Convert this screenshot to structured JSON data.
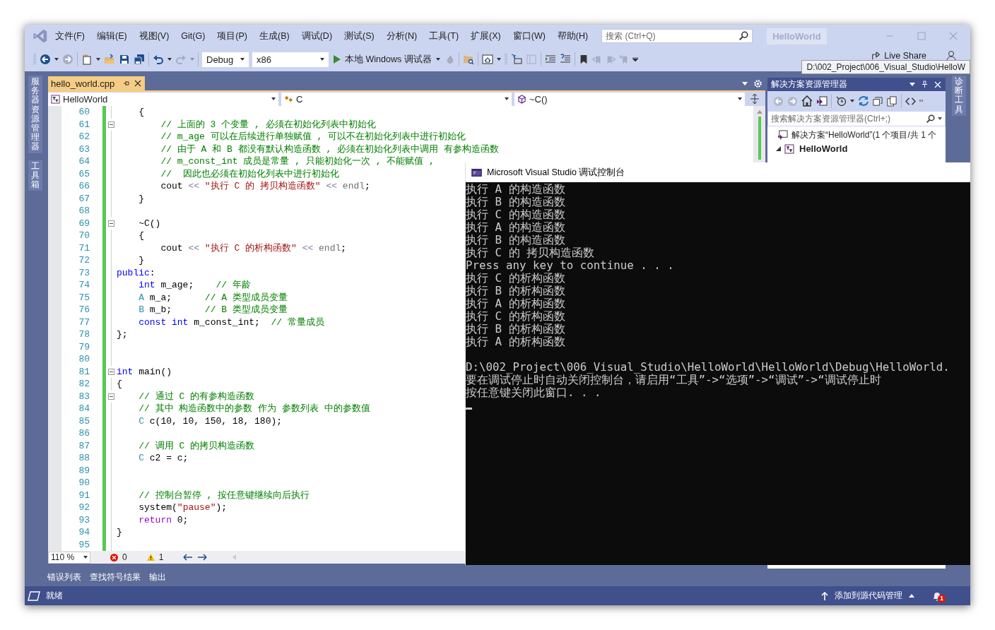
{
  "menu": [
    "文件(F)",
    "编辑(E)",
    "视图(V)",
    "Git(G)",
    "项目(P)",
    "生成(B)",
    "调试(D)",
    "测试(S)",
    "分析(N)",
    "工具(T)",
    "扩展(X)",
    "窗口(W)",
    "帮助(H)"
  ],
  "search": {
    "placeholder": "搜索 (Ctrl+Q)"
  },
  "solution_badge": "HelloWorld",
  "toolbar": {
    "configuration": "Debug",
    "platform": "x86",
    "start_label": "本地 Windows 调试器",
    "live_share": "Live Share"
  },
  "tooltip": "D:\\002_Project\\006_Visual_Studio\\HelloW",
  "left_strip": [
    "服务器资源管理器",
    "工具箱"
  ],
  "right_strip": [
    "诊断工具"
  ],
  "editor": {
    "tabs": [
      {
        "label": "hello_world.cpp",
        "selected": true
      }
    ],
    "nav": [
      "HelloWorld",
      "C",
      "~C()"
    ],
    "lines": [
      {
        "number": "60",
        "fold": false,
        "segs": [
          {
            "kind": "plain",
            "text": "    {"
          }
        ]
      },
      {
        "number": "61",
        "fold": true,
        "segs": [
          {
            "kind": "comment",
            "text": "        // 上面的 3 个变量 , 必须在初始化列表中初始化"
          }
        ]
      },
      {
        "number": "62",
        "fold": false,
        "segs": [
          {
            "kind": "comment",
            "text": "        // m_age 可以在后续进行单独赋值 , 可以不在初始化列表中进行初始化"
          }
        ]
      },
      {
        "number": "63",
        "fold": false,
        "segs": [
          {
            "kind": "comment",
            "text": "        // 由于 A 和 B 都没有默认构造函数 , 必须在初始化列表中调用 有参构造函数"
          }
        ]
      },
      {
        "number": "64",
        "fold": false,
        "segs": [
          {
            "kind": "comment",
            "text": "        // m_const_int 成员是常量 , 只能初始化一次 , 不能赋值 ,"
          }
        ]
      },
      {
        "number": "65",
        "fold": false,
        "segs": [
          {
            "kind": "comment",
            "text": "        //  因此也必须在初始化列表中进行初始化"
          }
        ]
      },
      {
        "number": "66",
        "fold": false,
        "segs": [
          {
            "kind": "plain",
            "text": "        cout "
          },
          {
            "kind": "op",
            "text": "<< "
          },
          {
            "kind": "string",
            "text": "\"执行 C 的 拷贝构造函数\""
          },
          {
            "kind": "op",
            "text": " << "
          },
          {
            "kind": "macro",
            "text": "endl"
          },
          {
            "kind": "plain",
            "text": ";"
          }
        ]
      },
      {
        "number": "67",
        "fold": false,
        "segs": [
          {
            "kind": "plain",
            "text": "    }"
          }
        ]
      },
      {
        "number": "68",
        "fold": false
      },
      {
        "number": "69",
        "fold": true,
        "segs": [
          {
            "kind": "plain",
            "text": "    ~C()"
          }
        ]
      },
      {
        "number": "70",
        "fold": false,
        "segs": [
          {
            "kind": "plain",
            "text": "    {"
          }
        ]
      },
      {
        "number": "71",
        "fold": false,
        "segs": [
          {
            "kind": "plain",
            "text": "        cout "
          },
          {
            "kind": "op",
            "text": "<< "
          },
          {
            "kind": "string",
            "text": "\"执行 C 的析构函数\""
          },
          {
            "kind": "op",
            "text": " << "
          },
          {
            "kind": "macro",
            "text": "endl"
          },
          {
            "kind": "plain",
            "text": ";"
          }
        ]
      },
      {
        "number": "72",
        "fold": false,
        "segs": [
          {
            "kind": "plain",
            "text": "    }"
          }
        ]
      },
      {
        "number": "73",
        "fold": false,
        "segs": [
          {
            "kind": "keyword",
            "text": "public"
          },
          {
            "kind": "plain",
            "text": ":"
          }
        ]
      },
      {
        "number": "74",
        "fold": false,
        "segs": [
          {
            "kind": "keyword",
            "text": "    int"
          },
          {
            "kind": "plain",
            "text": " m_age;    "
          },
          {
            "kind": "comment",
            "text": "// 年龄"
          }
        ]
      },
      {
        "number": "75",
        "fold": false,
        "segs": [
          {
            "kind": "type",
            "text": "    A"
          },
          {
            "kind": "plain",
            "text": " m_a;      "
          },
          {
            "kind": "comment",
            "text": "// A 类型成员变量"
          }
        ]
      },
      {
        "number": "76",
        "fold": false,
        "segs": [
          {
            "kind": "type",
            "text": "    B"
          },
          {
            "kind": "plain",
            "text": " m_b;      "
          },
          {
            "kind": "comment",
            "text": "// B 类型成员变量"
          }
        ]
      },
      {
        "number": "77",
        "fold": false,
        "segs": [
          {
            "kind": "keyword",
            "text": "    const int"
          },
          {
            "kind": "plain",
            "text": " m_const_int;  "
          },
          {
            "kind": "comment",
            "text": "// 常量成员"
          }
        ]
      },
      {
        "number": "78",
        "fold": false,
        "segs": [
          {
            "kind": "plain",
            "text": "};"
          }
        ]
      },
      {
        "number": "79",
        "fold": false
      },
      {
        "number": "80",
        "fold": false
      },
      {
        "number": "81",
        "fold": true,
        "segs": [
          {
            "kind": "keyword",
            "text": "int"
          },
          {
            "kind": "plain",
            "text": " main()"
          }
        ]
      },
      {
        "number": "82",
        "fold": false,
        "segs": [
          {
            "kind": "plain",
            "text": "{"
          }
        ]
      },
      {
        "number": "83",
        "fold": true,
        "segs": [
          {
            "kind": "comment",
            "text": "    // 通过 C 的有参构造函数"
          }
        ]
      },
      {
        "number": "84",
        "fold": false,
        "segs": [
          {
            "kind": "comment",
            "text": "    // 其中 构造函数中的参数 作为 参数列表 中的参数值"
          }
        ]
      },
      {
        "number": "85",
        "fold": false,
        "segs": [
          {
            "kind": "type",
            "text": "    C"
          },
          {
            "kind": "plain",
            "text": " c(10, 10, 150, 18, 180);"
          }
        ]
      },
      {
        "number": "86",
        "fold": false
      },
      {
        "number": "87",
        "fold": false,
        "segs": [
          {
            "kind": "comment",
            "text": "    // 调用 C 的拷贝构造函数"
          }
        ]
      },
      {
        "number": "88",
        "fold": false,
        "segs": [
          {
            "kind": "type",
            "text": "    C"
          },
          {
            "kind": "plain",
            "text": " c2 = c;"
          }
        ]
      },
      {
        "number": "89",
        "fold": false
      },
      {
        "number": "90",
        "fold": false
      },
      {
        "number": "91",
        "fold": false,
        "segs": [
          {
            "kind": "comment",
            "text": "    // 控制台暂停 , 按任意键继续向后执行"
          }
        ]
      },
      {
        "number": "92",
        "fold": false,
        "segs": [
          {
            "kind": "plain",
            "text": "    system("
          },
          {
            "kind": "string",
            "text": "\"pause\""
          },
          {
            "kind": "plain",
            "text": ");"
          }
        ]
      },
      {
        "number": "93",
        "fold": false,
        "segs": [
          {
            "kind": "control",
            "text": "    return"
          },
          {
            "kind": "plain",
            "text": " 0;"
          }
        ]
      },
      {
        "number": "94",
        "fold": false,
        "segs": [
          {
            "kind": "plain",
            "text": "}"
          }
        ]
      },
      {
        "number": "95",
        "fold": false
      }
    ],
    "zoom": "110 %",
    "errors": "0",
    "warnings": "1"
  },
  "solution_explorer": {
    "title": "解决方案资源管理器",
    "search": {
      "placeholder": "搜索解决方案资源管理器(Ctrl+;)"
    },
    "tree": [
      {
        "label": "解决方案“HelloWorld”(1 个项目/共 1 个",
        "kind": "solution",
        "children": [
          {
            "label": "HelloWorld",
            "kind": "project",
            "expanded": true
          }
        ]
      }
    ]
  },
  "console": {
    "title": "Microsoft Visual Studio 调试控制台",
    "output": [
      "执行 A 的构造函数",
      "执行 B 的构造函数",
      "执行 C 的构造函数",
      "执行 A 的构造函数",
      "执行 B 的构造函数",
      "执行 C 的 拷贝构造函数",
      "Press any key to continue . . .",
      "执行 C 的析构函数",
      "执行 B 的析构函数",
      "执行 A 的析构函数",
      "执行 C 的析构函数",
      "执行 B 的析构函数",
      "执行 A 的析构函数"
    ],
    "messages": [
      "D:\\002_Project\\006_Visual_Studio\\HelloWorld\\HelloWorld\\Debug\\HelloWorld.",
      "要在调试停止时自动关闭控制台，请启用“工具”->“选项”->“调试”->“调试停止时",
      "按任意键关闭此窗口. . ."
    ]
  },
  "bottom_tabs": [
    "错误列表",
    "查找符号结果",
    "输出"
  ],
  "status_bar": {
    "text": "就绪",
    "source_control": "添加到源代码管理",
    "notifications": "1"
  }
}
